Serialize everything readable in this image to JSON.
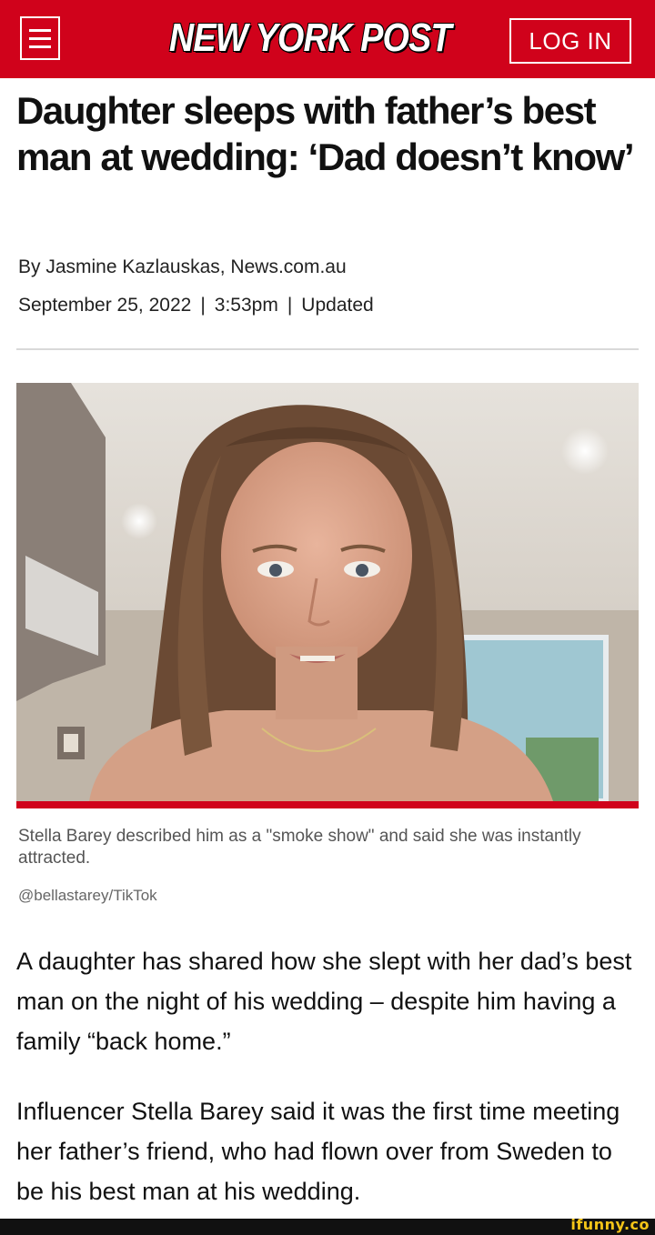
{
  "header": {
    "logo": "NEW YORK POST",
    "login_label": "LOG IN",
    "menu_icon": "hamburger-menu-icon"
  },
  "article": {
    "headline": "Daughter sleeps with father’s best man at wedding: ‘Dad doesn’t know’",
    "byline": "By Jasmine Kazlauskas, News.com.au",
    "date": "September 25, 2022",
    "time": "3:53pm",
    "updated": "Updated",
    "separator": "|",
    "caption": "Stella Barey described him as a \"smoke show\" and said she was instantly attracted.",
    "credit": "@bellastarey/TikTok",
    "paragraphs": [
      "A daughter has shared how she slept with her dad’s best man on the night of his wedding – despite him having a family “back home.”",
      "Influencer Stella Barey said it was the first time meeting her father’s friend, who had flown over from Sweden to be his best man at his wedding."
    ]
  },
  "watermark": "ifunny.co",
  "colors": {
    "brand_red": "#d0021b",
    "text": "#111111",
    "caption_gray": "#555555"
  }
}
